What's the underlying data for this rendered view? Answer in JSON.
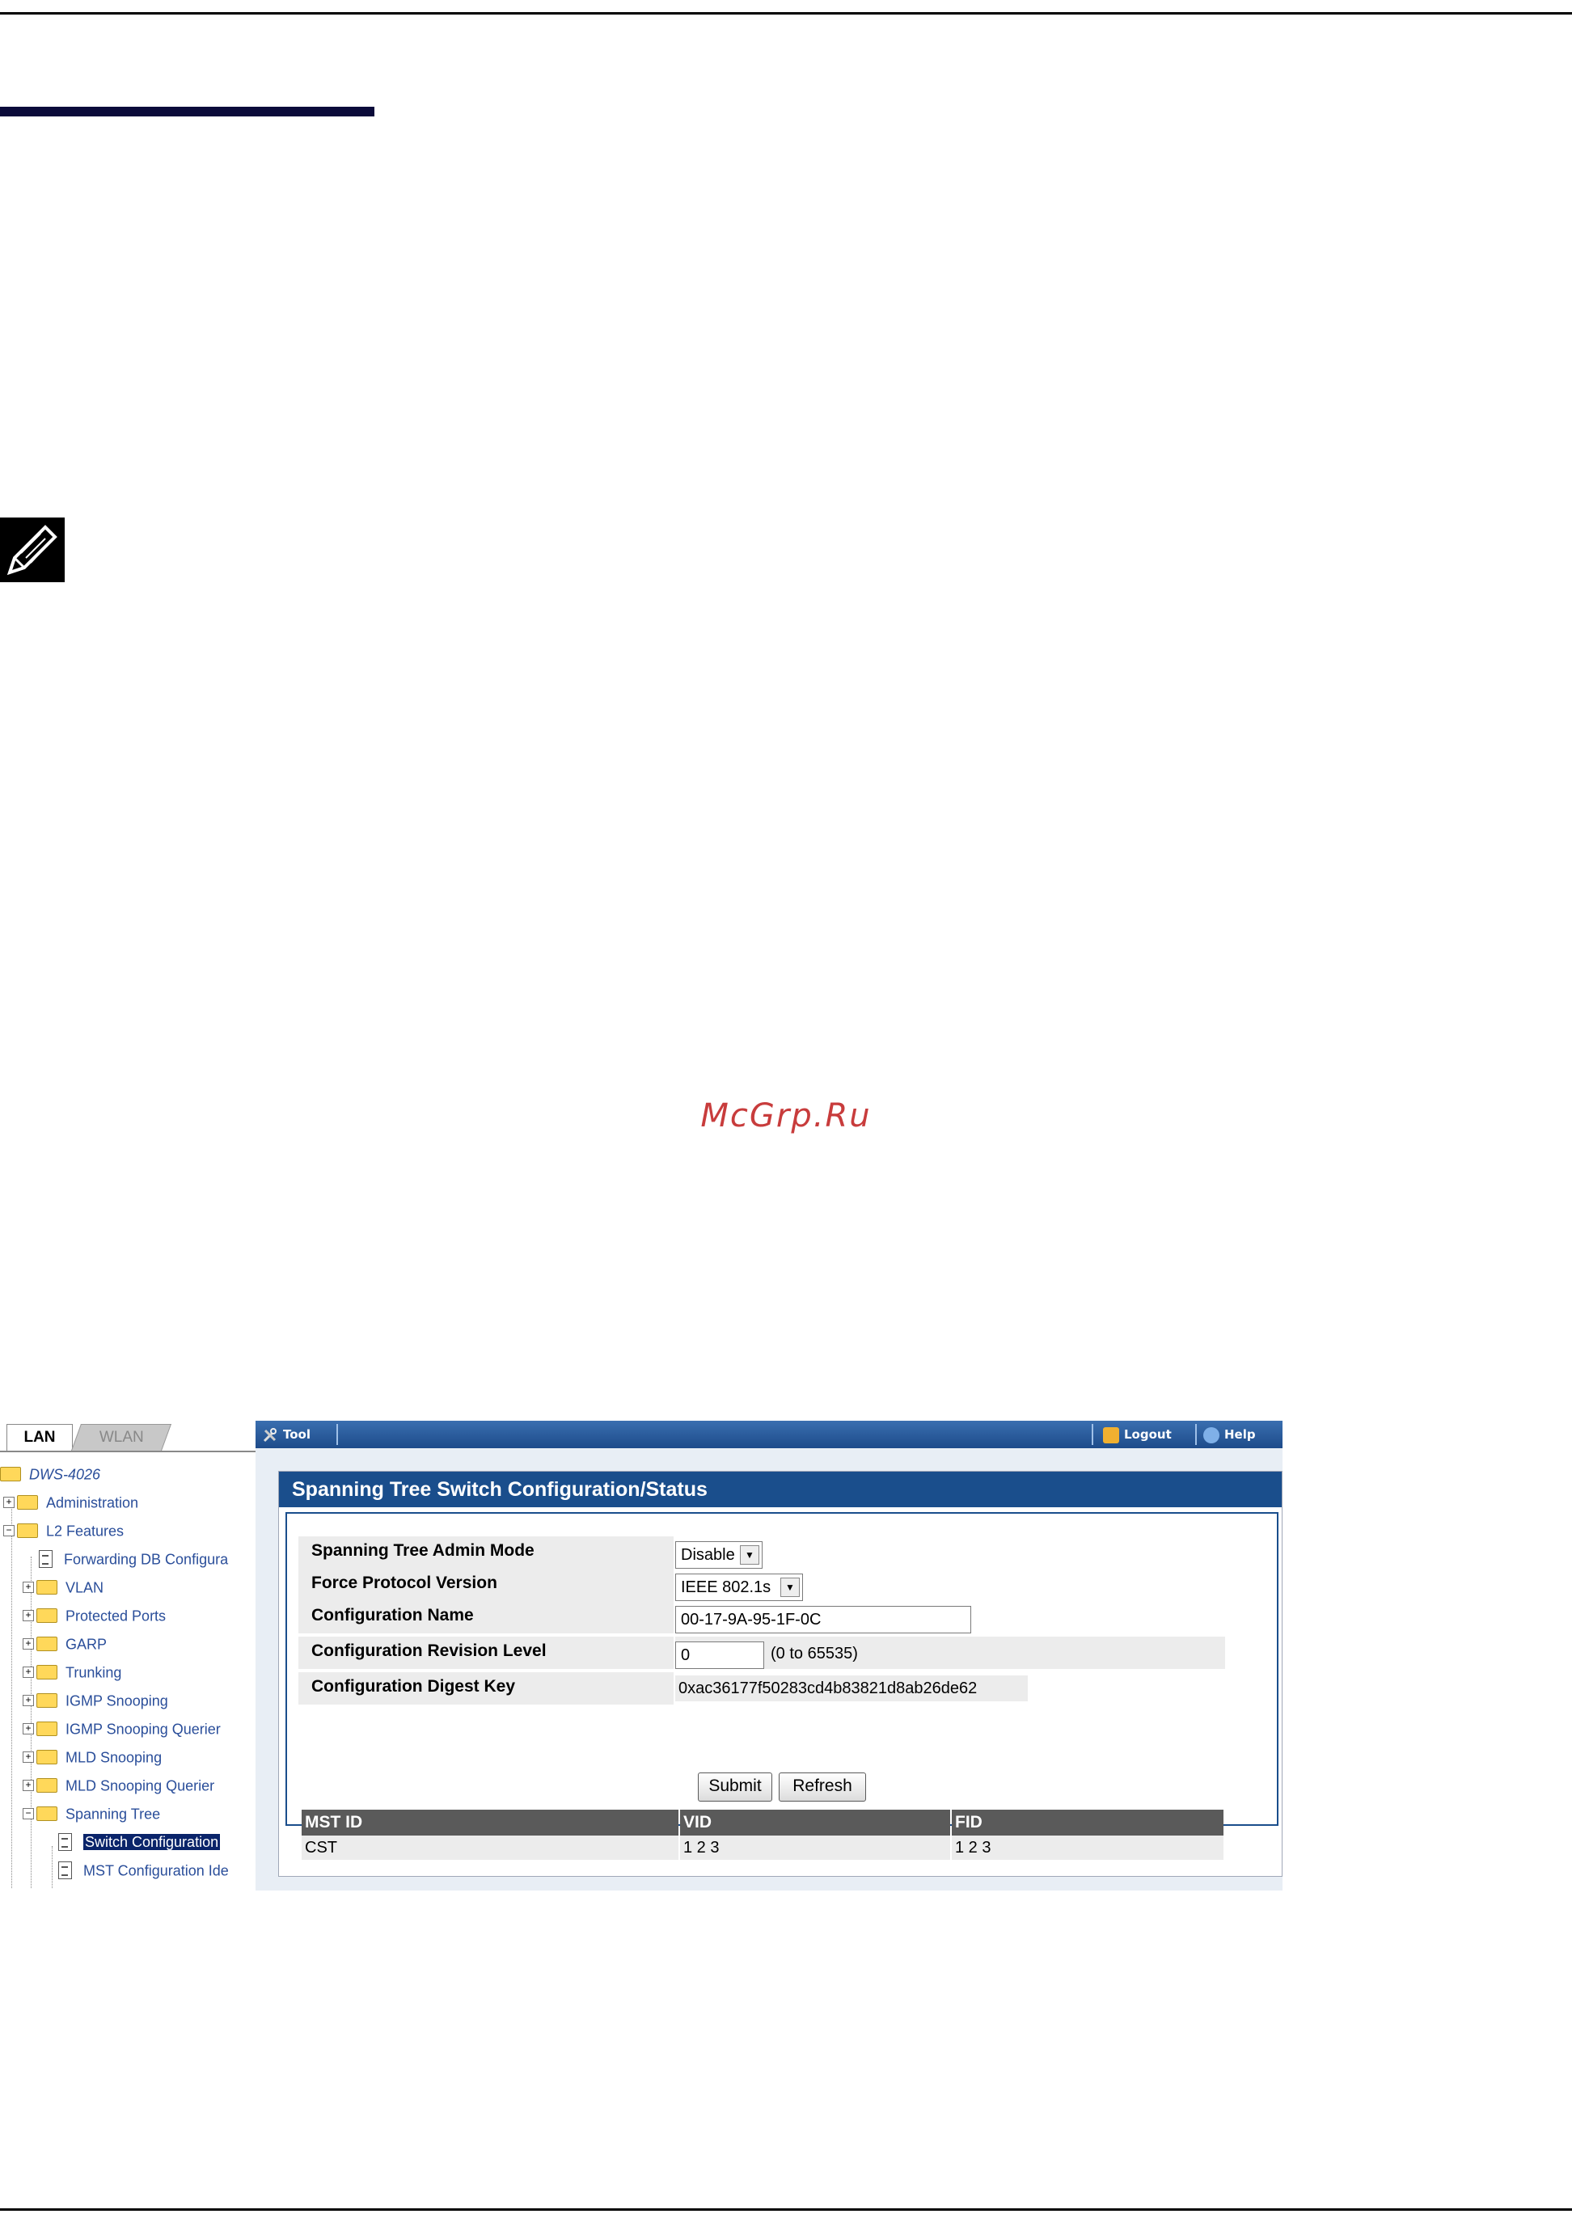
{
  "watermark": "McGrp.Ru",
  "screenshot": {
    "tabs": {
      "lan": "LAN",
      "wlan": "WLAN"
    },
    "toolbar": {
      "tool": "Tool",
      "logout": "Logout",
      "help": "Help"
    },
    "tree": {
      "root": "DWS-4026",
      "administration": "Administration",
      "l2_features": "L2 Features",
      "forwarding_db": "Forwarding DB Configura",
      "vlan": "VLAN",
      "protected_ports": "Protected Ports",
      "garp": "GARP",
      "trunking": "Trunking",
      "igmp_snooping": "IGMP Snooping",
      "igmp_snooping_querier": "IGMP Snooping Querier",
      "mld_snooping": "MLD Snooping",
      "mld_snooping_querier": "MLD Snooping Querier",
      "spanning_tree": "Spanning Tree",
      "switch_configuration": "Switch Configuration",
      "mst_configuration": "MST Configuration Ide"
    },
    "panel_title": "Spanning Tree Switch Configuration/Status",
    "form": {
      "admin_mode_label": "Spanning Tree Admin Mode",
      "admin_mode_value": "Disable",
      "force_protocol_label": "Force Protocol Version",
      "force_protocol_value": "IEEE 802.1s",
      "config_name_label": "Configuration Name",
      "config_name_value": "00-17-9A-95-1F-0C",
      "revision_label": "Configuration Revision Level",
      "revision_value": "0",
      "revision_hint": "(0 to 65535)",
      "digest_label": "Configuration Digest Key",
      "digest_value": "0xac36177f50283cd4b83821d8ab26de62"
    },
    "buttons": {
      "submit": "Submit",
      "refresh": "Refresh"
    },
    "table": {
      "headers": [
        "MST ID",
        "VID",
        "FID"
      ],
      "rows": [
        [
          "CST",
          "1 2 3",
          "1 2 3"
        ]
      ]
    }
  }
}
